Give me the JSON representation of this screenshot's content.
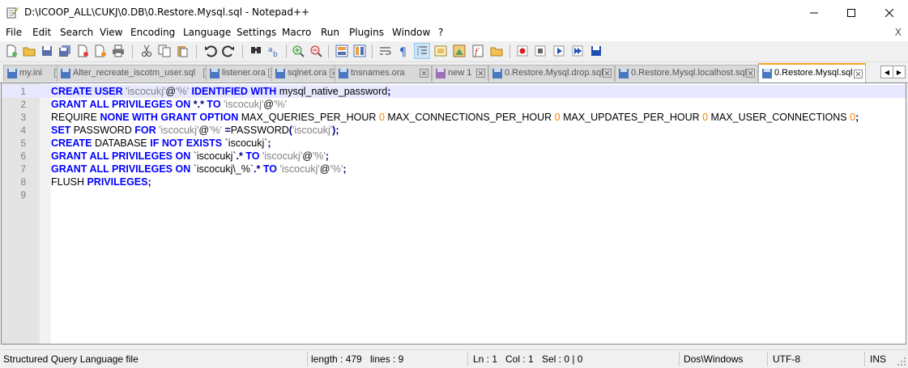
{
  "window": {
    "title": "D:\\ICOOP_ALL\\CUKJ\\0.DB\\0.Restore.Mysql.sql - Notepad++"
  },
  "menu": {
    "items": [
      "File",
      "Edit",
      "Search",
      "View",
      "Encoding",
      "Language",
      "Settings",
      "Macro",
      "Run",
      "Plugins",
      "Window",
      "?"
    ],
    "close": "X"
  },
  "tabs": [
    {
      "label": "my.ini",
      "active": false
    },
    {
      "label": "Alter_recreate_iscotm_user.sql",
      "active": false
    },
    {
      "label": "listener.ora",
      "active": false
    },
    {
      "label": "sqlnet.ora",
      "active": false
    },
    {
      "label": "tnsnames.ora",
      "active": false
    },
    {
      "label": "new 1",
      "active": false
    },
    {
      "label": "0.Restore.Mysql.drop.sql",
      "active": false
    },
    {
      "label": "0.Restore.Mysql.localhost.sql",
      "active": false
    },
    {
      "label": "0.Restore.Mysql.sql",
      "active": true
    }
  ],
  "editor": {
    "line_numbers": [
      "1",
      "2",
      "3",
      "4",
      "5",
      "6",
      "7",
      "8",
      "9"
    ],
    "lines": [
      [
        [
          "kw",
          "CREATE USER"
        ],
        [
          "t",
          " "
        ],
        [
          "str",
          "'iscocukj'"
        ],
        [
          "t",
          "@"
        ],
        [
          "str",
          "'%'"
        ],
        [
          "t",
          " "
        ],
        [
          "kw",
          "IDENTIFIED WITH"
        ],
        [
          "t",
          " mysql_native_password"
        ],
        [
          "op",
          ";"
        ]
      ],
      [
        [
          "kw",
          "GRANT ALL PRIVILEGES ON"
        ],
        [
          "t",
          " "
        ],
        [
          "op",
          "*.*"
        ],
        [
          "t",
          " "
        ],
        [
          "kw",
          "TO"
        ],
        [
          "t",
          " "
        ],
        [
          "str",
          "'iscocukj'"
        ],
        [
          "t",
          "@"
        ],
        [
          "str",
          "'%'"
        ]
      ],
      [
        [
          "t",
          "REQUIRE "
        ],
        [
          "kw",
          "NONE WITH GRANT OPTION"
        ],
        [
          "t",
          " MAX_QUERIES_PER_HOUR "
        ],
        [
          "num",
          "0"
        ],
        [
          "t",
          " MAX_CONNECTIONS_PER_HOUR "
        ],
        [
          "num",
          "0"
        ],
        [
          "t",
          " MAX_UPDATES_PER_HOUR "
        ],
        [
          "num",
          "0"
        ],
        [
          "t",
          " MAX_USER_CONNECTIONS "
        ],
        [
          "num",
          "0"
        ],
        [
          "op",
          ";"
        ]
      ],
      [
        [
          "kw",
          "SET"
        ],
        [
          "t",
          " PASSWORD "
        ],
        [
          "kw",
          "FOR"
        ],
        [
          "t",
          " "
        ],
        [
          "str",
          "'iscocukj'"
        ],
        [
          "t",
          "@"
        ],
        [
          "str",
          "'%'"
        ],
        [
          "t",
          " "
        ],
        [
          "op",
          "="
        ],
        [
          "t",
          "PASSWORD"
        ],
        [
          "op",
          "("
        ],
        [
          "str",
          "'iscocukj'"
        ],
        [
          "op",
          ");"
        ]
      ],
      [
        [
          "kw",
          "CREATE"
        ],
        [
          "t",
          " DATABASE "
        ],
        [
          "kw",
          "IF NOT EXISTS"
        ],
        [
          "t",
          " `iscocukj`"
        ],
        [
          "op",
          ";"
        ]
      ],
      [
        [
          "kw",
          "GRANT ALL PRIVILEGES ON"
        ],
        [
          "t",
          " `iscocukj`"
        ],
        [
          "op",
          ".*"
        ],
        [
          "t",
          " "
        ],
        [
          "kw",
          "TO"
        ],
        [
          "t",
          " "
        ],
        [
          "str",
          "'iscocukj'"
        ],
        [
          "t",
          "@"
        ],
        [
          "str",
          "'%'"
        ],
        [
          "op",
          ";"
        ]
      ],
      [
        [
          "kw",
          "GRANT ALL PRIVILEGES ON"
        ],
        [
          "t",
          " `iscocukj\\_%`"
        ],
        [
          "op",
          ".*"
        ],
        [
          "t",
          " "
        ],
        [
          "kw",
          "TO"
        ],
        [
          "t",
          " "
        ],
        [
          "str",
          "'iscocukj'"
        ],
        [
          "t",
          "@"
        ],
        [
          "str",
          "'%'"
        ],
        [
          "op",
          ";"
        ]
      ],
      [
        [
          "t",
          "FLUSH "
        ],
        [
          "kw",
          "PRIVILEGES"
        ],
        [
          "op",
          ";"
        ]
      ],
      []
    ]
  },
  "status": {
    "file_type": "Structured Query Language file",
    "length": "length : 479",
    "lines": "lines : 9",
    "ln": "Ln : 1",
    "col": "Col : 1",
    "sel": "Sel : 0 | 0",
    "eol": "Dos\\Windows",
    "encoding": "UTF-8",
    "mode": "INS"
  }
}
